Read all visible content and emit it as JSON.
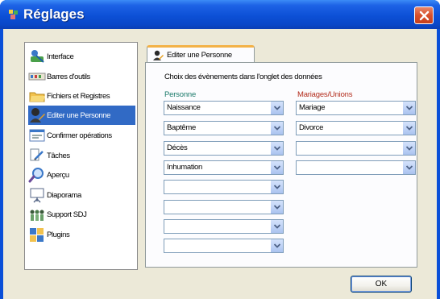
{
  "window": {
    "title": "Réglages"
  },
  "sidebar": {
    "items": [
      {
        "label": "Interface",
        "icon": "interface-icon"
      },
      {
        "label": "Barres d'outils",
        "icon": "toolbars-icon"
      },
      {
        "label": "Fichiers et Registres",
        "icon": "folder-icon"
      },
      {
        "label": "Editer une Personne",
        "icon": "person-edit-icon",
        "selected": true
      },
      {
        "label": "Confirmer opérations",
        "icon": "confirm-icon"
      },
      {
        "label": "Tâches",
        "icon": "tasks-icon"
      },
      {
        "label": "Aperçu",
        "icon": "preview-icon"
      },
      {
        "label": "Diaporama",
        "icon": "slideshow-icon"
      },
      {
        "label": "Support SDJ",
        "icon": "support-icon"
      },
      {
        "label": "Plugins",
        "icon": "plugins-icon"
      }
    ]
  },
  "tab": {
    "label": "Editer une Personne"
  },
  "panel": {
    "description": "Choix des évènements dans l'onglet des données",
    "person_header": "Personne",
    "unions_header": "Mariages/Unions",
    "person_events": [
      "Naissance",
      "Baptême",
      "Décès",
      "Inhumation",
      "",
      "",
      "",
      ""
    ],
    "union_events": [
      "Mariage",
      "Divorce",
      "",
      ""
    ]
  },
  "buttons": {
    "ok": "OK"
  },
  "colors": {
    "titlebar": "#0a4fd8",
    "selection": "#316ac5",
    "tab_accent": "#f3b247",
    "person_header": "#1a7a6a",
    "unions_header": "#b22a1a"
  }
}
